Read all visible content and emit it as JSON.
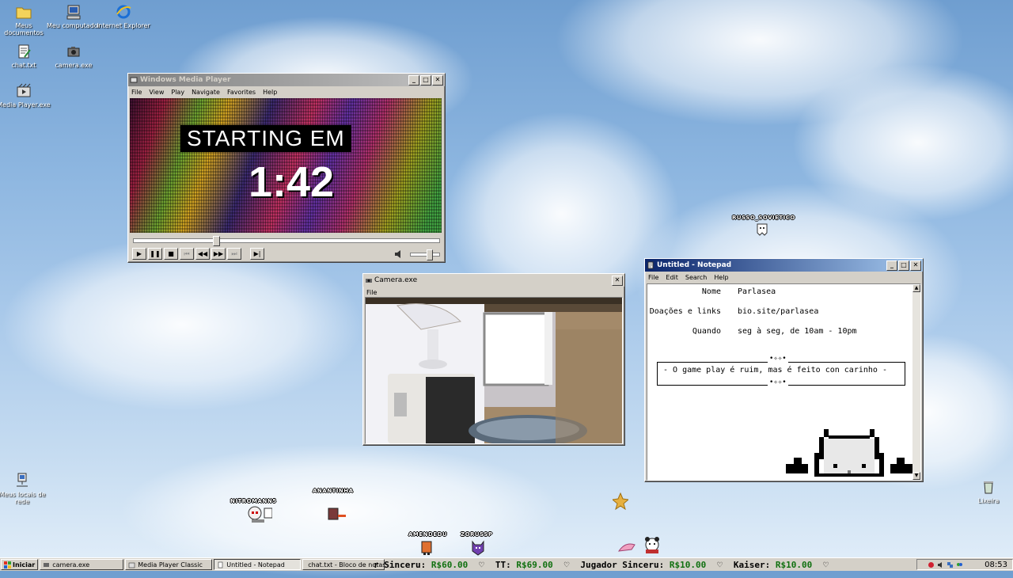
{
  "desktop_icons": [
    {
      "label": "Meus documentos"
    },
    {
      "label": "Meu computador"
    },
    {
      "label": "Internet Explorer"
    },
    {
      "label": "chat.txt"
    },
    {
      "label": "camera.exe"
    },
    {
      "label": "Media Player.exe"
    },
    {
      "label": "Meus locais de rede"
    },
    {
      "label": "Lixeira"
    }
  ],
  "media_player": {
    "title": "Windows Media Player",
    "menu": [
      "File",
      "View",
      "Play",
      "Navigate",
      "Favorites",
      "Help"
    ],
    "video_heading": "STARTING EM",
    "countdown": "1:42",
    "seek_progress": 0.26,
    "volume_level": 0.55,
    "controls": [
      "play",
      "pause",
      "stop",
      "skip-back",
      "rewind",
      "fast-forward",
      "skip-forward",
      "preview"
    ]
  },
  "camera": {
    "title": "Camera.exe",
    "menu": [
      "File"
    ]
  },
  "notepad": {
    "title": "Untitled - Notepad",
    "menu": [
      "File",
      "Edit",
      "Search",
      "Help"
    ],
    "rows": [
      {
        "label": "Nome",
        "value": "Parlasea"
      },
      {
        "label": "Doações e links",
        "value": "bio.site/parlasea"
      },
      {
        "label": "Quando",
        "value": "seg à seg, de 10am - 10pm"
      }
    ],
    "ornament": "•✧✧•",
    "banner": "- O game play é ruim, mas é feito con carinho -"
  },
  "chat_avatars": [
    {
      "nick": "RUSSO_SOVIETICO"
    },
    {
      "nick": "NITROMANN5"
    },
    {
      "nick": "ANANTINHA"
    },
    {
      "nick": "AMENDEDU"
    },
    {
      "nick": "ZORUSSP"
    }
  ],
  "taskbar": {
    "start_label": "Iniciar",
    "tasks": [
      {
        "label": "camera.exe"
      },
      {
        "label": "Media Player Classic"
      },
      {
        "label": "Untitled - Notepad"
      },
      {
        "label": "chat.txt - Bloco de notas"
      }
    ],
    "donations": [
      {
        "name": "r Sinceru:",
        "amount": "R$60.00"
      },
      {
        "name": "TT:",
        "amount": "R$69.00"
      },
      {
        "name": "Jugador Sinceru:",
        "amount": "R$10.00"
      },
      {
        "name": "Kaiser:",
        "amount": "R$10.00"
      }
    ],
    "clock": "08:53"
  },
  "colors": {
    "title_active": "#0a246a",
    "title_inactive": "#808080",
    "window_face": "#d4d0c8",
    "donation_amount": "#107010"
  }
}
